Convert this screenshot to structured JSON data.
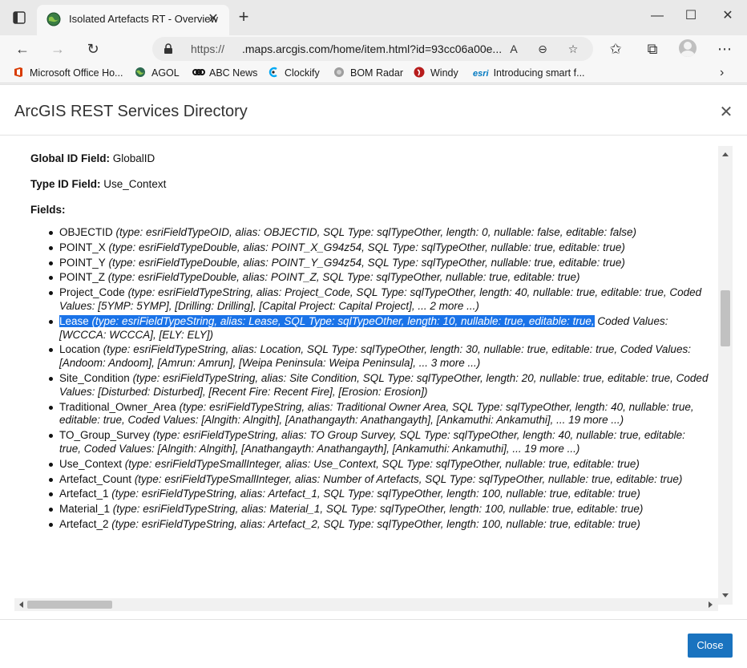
{
  "browser": {
    "tab_title": "Isolated Artefacts RT - Overview",
    "url_scheme": "https://",
    "url_host": ".maps.arcgis.com/home/item.html?id=93cc06a00e...",
    "favorites": [
      {
        "label": "Microsoft Office Ho...",
        "icon": "office-icon",
        "color": "#d83b01"
      },
      {
        "label": "AGOL",
        "icon": "globe-icon",
        "color": "#2d6a4f"
      },
      {
        "label": "ABC News",
        "icon": "abc-icon",
        "color": "#111111"
      },
      {
        "label": "Clockify",
        "icon": "clockify-icon",
        "color": "#03a9f4"
      },
      {
        "label": "BOM Radar",
        "icon": "radar-icon",
        "color": "#888888"
      },
      {
        "label": "Windy",
        "icon": "windy-icon",
        "color": "#b71c1c"
      },
      {
        "label": "Introducing smart f...",
        "icon": "esri-icon",
        "color": "#0079c1"
      }
    ],
    "esri_badge": "esri"
  },
  "dialog": {
    "title": "ArcGIS REST Services Directory",
    "close_label": "Close",
    "global_id_label": "Global ID Field:",
    "global_id_value": "GlobalID",
    "type_id_label": "Type ID Field:",
    "type_id_value": "Use_Context",
    "fields_label": "Fields:",
    "fields": [
      {
        "name": "OBJECTID",
        "desc": " (type: esriFieldTypeOID, alias: OBJECTID, SQL Type: sqlTypeOther, length: 0, nullable: false, editable: false)"
      },
      {
        "name": "POINT_X",
        "desc": " (type: esriFieldTypeDouble, alias: POINT_X_G94z54, SQL Type: sqlTypeOther, nullable: true, editable: true)"
      },
      {
        "name": "POINT_Y",
        "desc": " (type: esriFieldTypeDouble, alias: POINT_Y_G94z54, SQL Type: sqlTypeOther, nullable: true, editable: true)"
      },
      {
        "name": "POINT_Z",
        "desc": " (type: esriFieldTypeDouble, alias: POINT_Z, SQL Type: sqlTypeOther, nullable: true, editable: true)"
      },
      {
        "name": "Project_Code",
        "desc": " (type: esriFieldTypeString, alias: Project_Code, SQL Type: sqlTypeOther, length: 40, nullable: true, editable: true, Coded Values: [5YMP: 5YMP], [Drilling: Drilling], [Capital Project: Capital Project], ... 2 more ...)"
      },
      {
        "name": "Lease",
        "desc_selected": " (type: esriFieldTypeString, alias: Lease, SQL Type: sqlTypeOther, length: 10, nullable: true, editable: true,",
        "desc_rest": " Coded Values: [WCCCA: WCCCA], [ELY: ELY])",
        "selected": true
      },
      {
        "name": "Location",
        "desc": " (type: esriFieldTypeString, alias: Location, SQL Type: sqlTypeOther, length: 30, nullable: true, editable: true, Coded Values: [Andoom: Andoom], [Amrun: Amrun], [Weipa Peninsula: Weipa Peninsula], ... 3 more ...)"
      },
      {
        "name": "Site_Condition",
        "desc": " (type: esriFieldTypeString, alias: Site Condition, SQL Type: sqlTypeOther, length: 20, nullable: true, editable: true, Coded Values: [Disturbed: Disturbed], [Recent Fire: Recent Fire], [Erosion: Erosion])"
      },
      {
        "name": "Traditional_Owner_Area",
        "desc": " (type: esriFieldTypeString, alias: Traditional Owner Area, SQL Type: sqlTypeOther, length: 40, nullable: true, editable: true, Coded Values: [Alngith: Alngith], [Anathangayth: Anathangayth], [Ankamuthi: Ankamuthi], ... 19 more ...)"
      },
      {
        "name": "TO_Group_Survey",
        "desc": " (type: esriFieldTypeString, alias: TO Group Survey, SQL Type: sqlTypeOther, length: 40, nullable: true, editable: true, Coded Values: [Alngith: Alngith], [Anathangayth: Anathangayth], [Ankamuthi: Ankamuthi], ... 19 more ...)"
      },
      {
        "name": "Use_Context",
        "desc": " (type: esriFieldTypeSmallInteger, alias: Use_Context, SQL Type: sqlTypeOther, nullable: true, editable: true)"
      },
      {
        "name": "Artefact_Count",
        "desc": " (type: esriFieldTypeSmallInteger, alias: Number of Artefacts, SQL Type: sqlTypeOther, nullable: true, editable: true)"
      },
      {
        "name": "Artefact_1",
        "desc": " (type: esriFieldTypeString, alias: Artefact_1, SQL Type: sqlTypeOther, length: 100, nullable: true, editable: true)"
      },
      {
        "name": "Material_1",
        "desc": " (type: esriFieldTypeString, alias: Material_1, SQL Type: sqlTypeOther, length: 100, nullable: true, editable: true)"
      },
      {
        "name": "Artefact_2",
        "desc": " (type: esriFieldTypeString, alias: Artefact_2, SQL Type: sqlTypeOther, length: 100, nullable: true, editable: true)"
      }
    ]
  },
  "colors": {
    "selection": "#1a73e8",
    "close_button": "#1a73bf"
  }
}
